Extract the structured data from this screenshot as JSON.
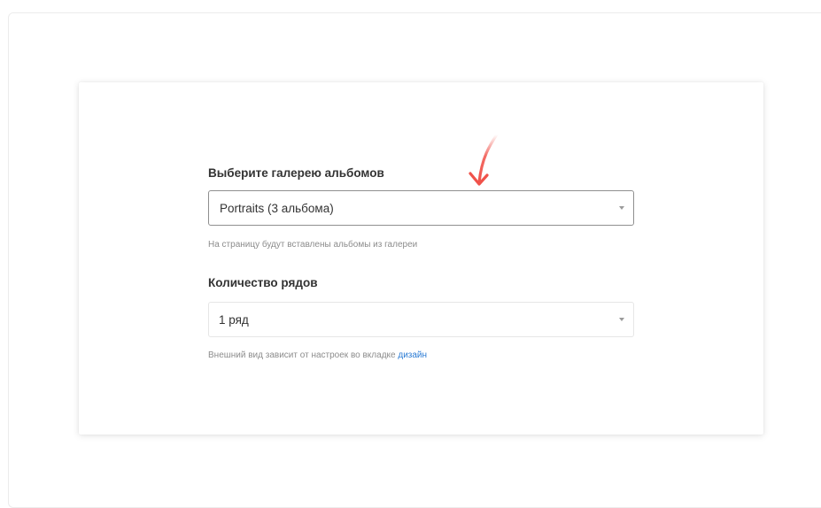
{
  "gallery_field": {
    "label": "Выберите галерею альбомов",
    "selected_value": "Portraits (3 альбома)",
    "hint": "На страницу будут вставлены альбомы из галереи"
  },
  "rows_field": {
    "label": "Количество рядов",
    "selected_value": "1 ряд",
    "hint_prefix": "Внешний вид зависит от настроек во вкладке",
    "hint_link": "дизайн"
  },
  "icons": {
    "annotation_arrow": "arrow-down-icon",
    "dropdown_chevron": "chevron-down-icon"
  },
  "colors": {
    "annotation_arrow": "#f0524a",
    "link": "#2a7bd4",
    "selected_border": "#8f8f8f"
  }
}
